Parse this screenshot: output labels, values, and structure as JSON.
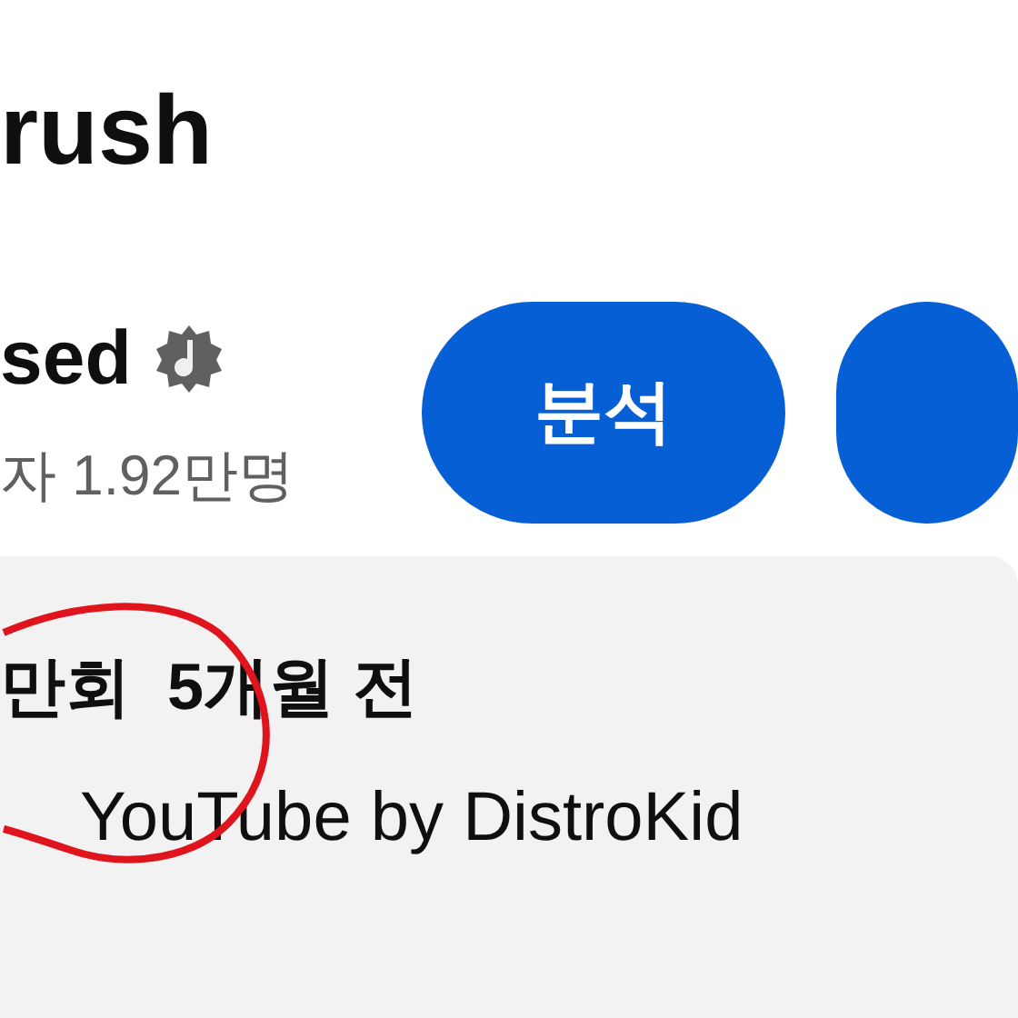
{
  "video_title": "rush",
  "channel": {
    "name": "sed",
    "verified": true,
    "subscribers": "자 1.92만명"
  },
  "buttons": [
    {
      "label": "분석",
      "kind": "primary"
    },
    {
      "kind": "primary"
    }
  ],
  "description": {
    "meta": "만회  5개월 전",
    "text": "YouTube by DistroKid"
  },
  "annotation": {
    "kind": "circle",
    "color": "#e0141c"
  }
}
